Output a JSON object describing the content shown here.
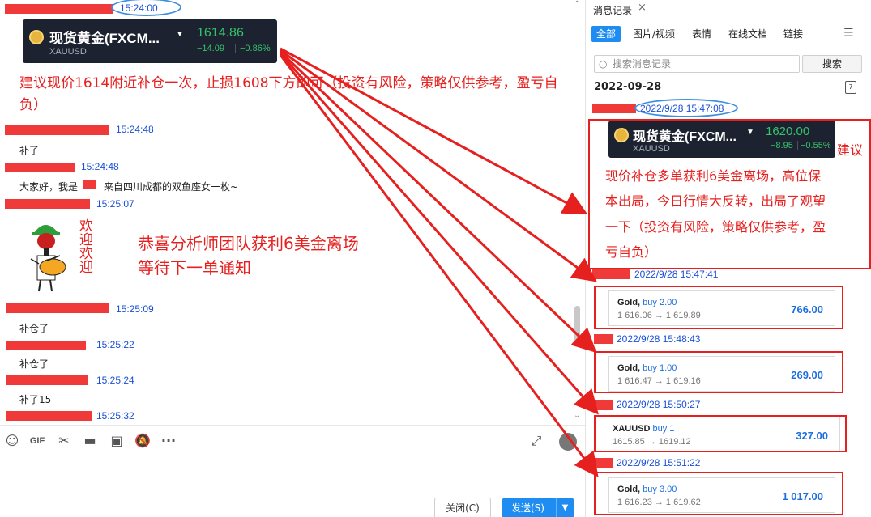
{
  "chat": {
    "messages": [
      {
        "time": "15:24:00"
      },
      {
        "time": "15:24:48",
        "text": "补了"
      },
      {
        "time": "15:24:48",
        "text": "大家好，我是",
        "text2": "来自四川成都的双鱼座女一枚~"
      },
      {
        "time": "15:25:07"
      },
      {
        "time": "15:25:09",
        "text": "补仓了"
      },
      {
        "time": "15:25:22",
        "text": "补仓了"
      },
      {
        "time": "15:25:24",
        "text": "补了15"
      },
      {
        "time": "15:25:32"
      }
    ],
    "quote_card": {
      "name": "现货黄金(FXCM...",
      "symbol": "XAUUSD",
      "price": "1614.86",
      "change": "−14.09",
      "percent": "−0.86%"
    },
    "annotation": "建议现价1614附近补仓一次，止损1608下方即可（投资有风险，策略仅供参考，盈亏自负）",
    "sticker": {
      "text": "欢迎欢迎"
    },
    "sticker_caption_line1": "恭喜分析师团队获利6美金离场",
    "sticker_caption_line2": "等待下一单通知"
  },
  "toolbar": {
    "icons": [
      "emoji-icon",
      "gif-icon",
      "scissors-icon",
      "folder-icon",
      "image-icon",
      "bell-off-icon",
      "more-icon"
    ],
    "gif_label": "GIF",
    "close_label": "关闭(C)",
    "send_label": "发送(S)"
  },
  "history": {
    "title": "消息记录",
    "tabs": [
      "全部",
      "图片/视频",
      "表情",
      "在线文档",
      "链接"
    ],
    "search_placeholder": "搜索消息记录",
    "search_button": "搜索",
    "date": "2022-09-28",
    "calendar_day": "7",
    "entries": [
      {
        "time": "2022/9/28 15:47:08"
      },
      {
        "time": "2022/9/28 15:47:41"
      },
      {
        "time": "2022/9/28 15:48:43"
      },
      {
        "time": "2022/9/28 15:50:27"
      },
      {
        "time": "2022/9/28 15:51:22"
      }
    ],
    "quote_card": {
      "name": "现货黄金(FXCM...",
      "symbol": "XAUUSD",
      "price": "1620.00",
      "change": "−8.95",
      "percent": "−0.55%"
    },
    "annotation_lines": [
      "建议",
      "现价补仓多单获利6美金离场，高位保",
      "本出局，今日行情大反转，出局了观望",
      "一下（投资有风险，策略仅供参考，盈",
      "亏自负）"
    ],
    "trades": [
      {
        "symbol": "Gold,",
        "side": "buy 2.00",
        "prices": "1 616.06 → 1 619.89",
        "profit": "766.00"
      },
      {
        "symbol": "Gold,",
        "side": "buy 1.00",
        "prices": "1 616.47 → 1 619.16",
        "profit": "269.00"
      },
      {
        "symbol": "XAUUSD",
        "side": "buy 1",
        "prices": "1615.85 → 1619.12",
        "profit": "327.00"
      },
      {
        "symbol": "Gold,",
        "side": "buy 3.00",
        "prices": "1 616.23 → 1 619.62",
        "profit": "1 017.00"
      }
    ]
  },
  "colors": {
    "accent": "#1e8cf0",
    "annotation": "#e6201f",
    "timestamp": "#1a4fd8",
    "price_down": "#35c36b"
  }
}
